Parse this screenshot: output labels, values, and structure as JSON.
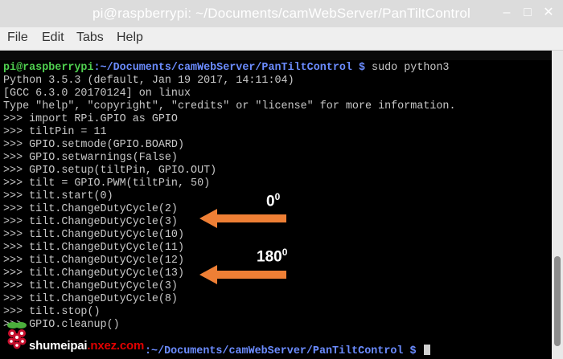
{
  "window": {
    "title": "pi@raspberrypi: ~/Documents/camWebServer/PanTiltControl"
  },
  "menu": [
    "File",
    "Edit",
    "Tabs",
    "Help"
  ],
  "prompt": {
    "user": "pi@raspberrypi",
    "path": ":~/Documents/camWebServer/PanTiltControl $",
    "command": " sudo python3"
  },
  "terminal_lines": [
    "Python 3.5.3 (default, Jan 19 2017, 14:11:04)",
    "[GCC 6.3.0 20170124] on linux",
    "Type \"help\", \"copyright\", \"credits\" or \"license\" for more information.",
    ">>> import RPi.GPIO as GPIO",
    ">>> tiltPin = 11",
    ">>> GPIO.setmode(GPIO.BOARD)",
    ">>> GPIO.setwarnings(False)",
    ">>> GPIO.setup(tiltPin, GPIO.OUT)",
    ">>> tilt = GPIO.PWM(tiltPin, 50)",
    ">>> tilt.start(0)",
    ">>> tilt.ChangeDutyCycle(2)",
    ">>> tilt.ChangeDutyCycle(3)",
    ">>> tilt.ChangeDutyCycle(10)",
    ">>> tilt.ChangeDutyCycle(11)",
    ">>> tilt.ChangeDutyCycle(12)",
    ">>> tilt.ChangeDutyCycle(13)",
    ">>> tilt.ChangeDutyCycle(3)",
    ">>> tilt.ChangeDutyCycle(8)",
    ">>> tilt.stop()",
    ">>> GPIO.cleanup()"
  ],
  "final_prompt": {
    "path": ":~/Documents/camWebServer/PanTiltControl $"
  },
  "annotations": {
    "first": {
      "value": "0",
      "sup": "0"
    },
    "second": {
      "value": "180",
      "sup": "0"
    },
    "arrow_color": "#ee7f35"
  },
  "watermark": {
    "prefix": "shumeipai",
    "domain": ".nxez.com"
  }
}
